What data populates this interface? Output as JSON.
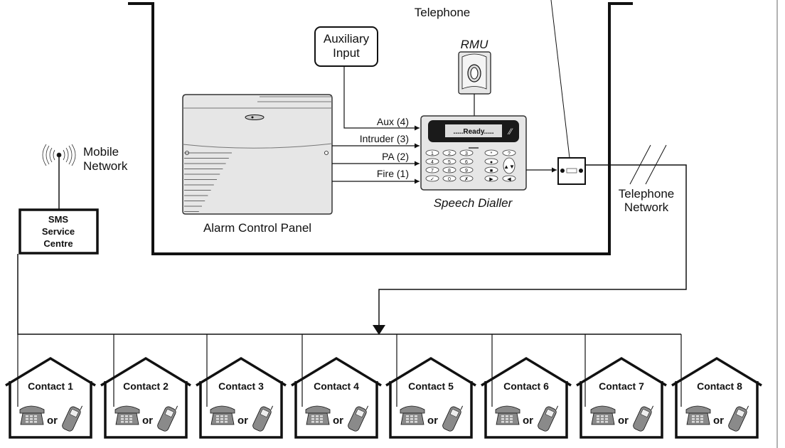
{
  "labels": {
    "telephone": "Telephone",
    "auxiliary_input_line1": "Auxiliary",
    "auxiliary_input_line2": "Input",
    "rmu": "RMU",
    "aux": "Aux (4)",
    "intruder": "Intruder (3)",
    "pa": "PA (2)",
    "fire": "Fire (1)",
    "display_text": ".....Ready.....",
    "speech_dialler": "Speech Dialler",
    "alarm_control_panel": "Alarm Control Panel",
    "mobile_network_line1": "Mobile",
    "mobile_network_line2": "Network",
    "sms_line1": "SMS",
    "sms_line2": "Service",
    "sms_line3": "Centre",
    "telephone_network_line1": "Telephone",
    "telephone_network_line2": "Network"
  },
  "keypad_keys": [
    "1",
    "2",
    "3",
    "*",
    "?",
    "4",
    "5",
    "6",
    "●",
    "▲▼",
    "7",
    "8",
    "9",
    "■",
    "",
    "✓",
    "0",
    "✗",
    "▶",
    "◀"
  ],
  "contacts": [
    {
      "label": "Contact 1",
      "or": "or"
    },
    {
      "label": "Contact 2",
      "or": "or"
    },
    {
      "label": "Contact 3",
      "or": "or"
    },
    {
      "label": "Contact 4",
      "or": "or"
    },
    {
      "label": "Contact 5",
      "or": "or"
    },
    {
      "label": "Contact 6",
      "or": "or"
    },
    {
      "label": "Contact 7",
      "or": "or"
    },
    {
      "label": "Contact 8",
      "or": "or"
    }
  ],
  "colors": {
    "line": "#111111",
    "device_fill": "#e6e6e6",
    "screen": "#1a1a1a",
    "phone_fill": "#8a8a8a"
  }
}
